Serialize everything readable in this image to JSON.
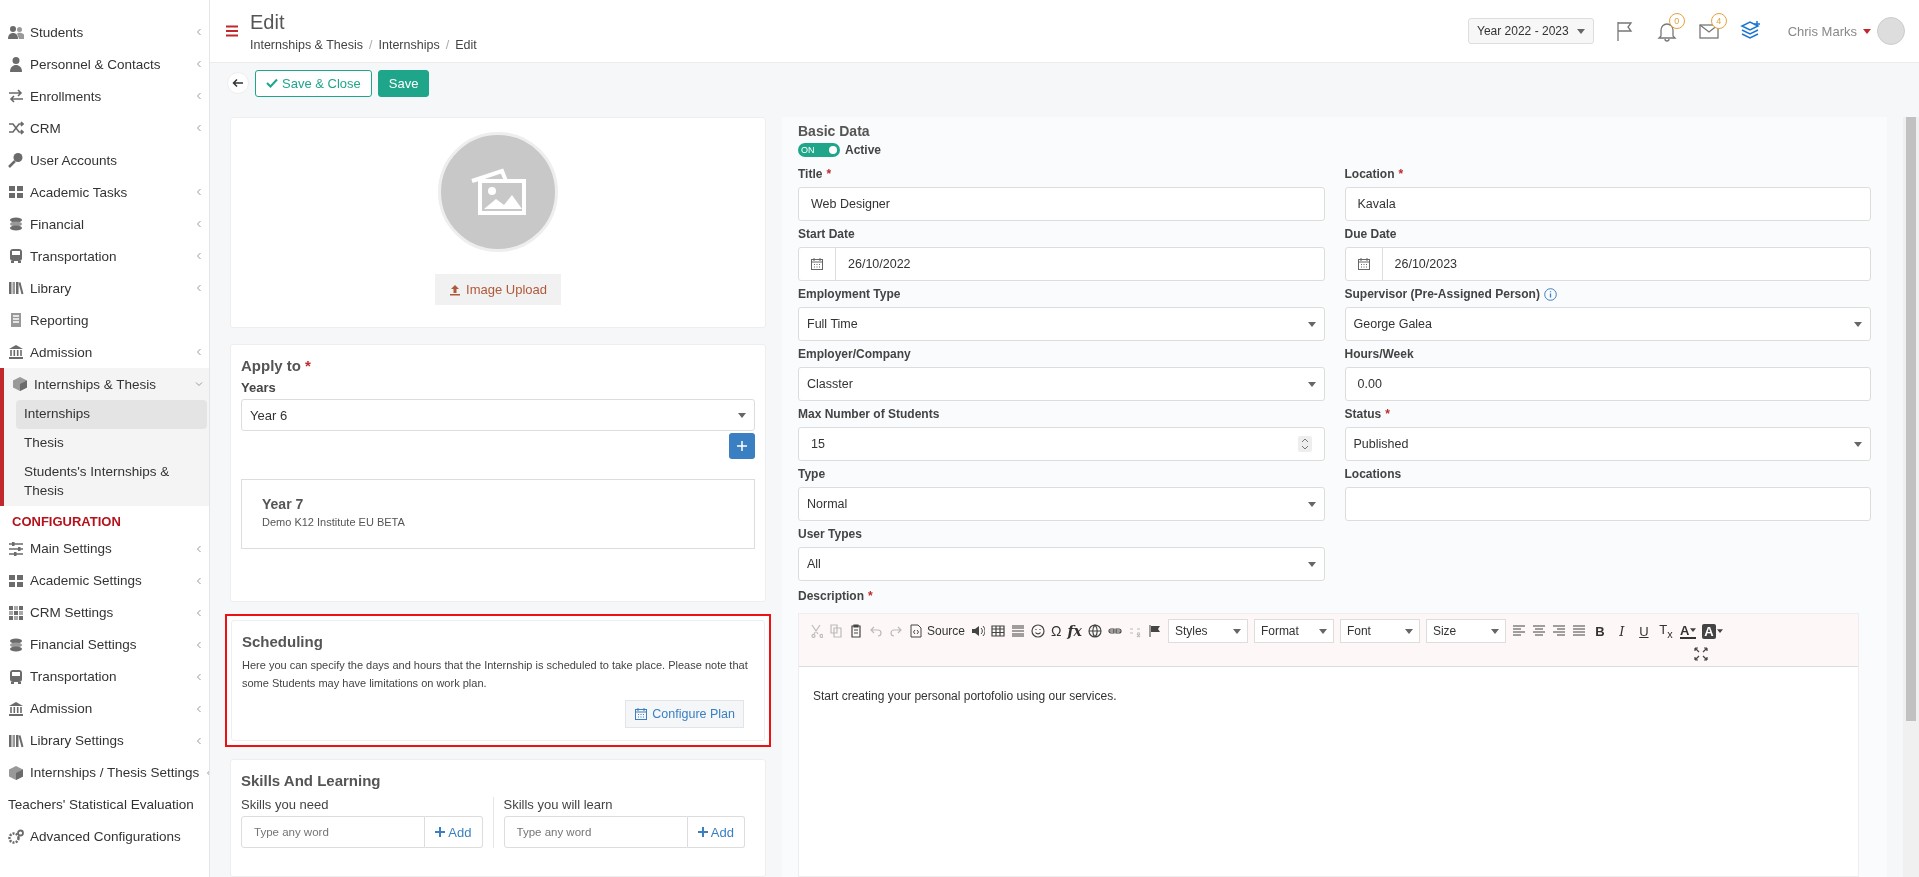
{
  "sidebar": {
    "items": [
      {
        "label": "Students",
        "expandable": true
      },
      {
        "label": "Personnel & Contacts",
        "expandable": true
      },
      {
        "label": "Enrollments",
        "expandable": true
      },
      {
        "label": "CRM",
        "expandable": true
      },
      {
        "label": "User Accounts",
        "expandable": false
      },
      {
        "label": "Academic Tasks",
        "expandable": true
      },
      {
        "label": "Financial",
        "expandable": true
      },
      {
        "label": "Transportation",
        "expandable": true
      },
      {
        "label": "Library",
        "expandable": true
      },
      {
        "label": "Reporting",
        "expandable": false
      },
      {
        "label": "Admission",
        "expandable": true
      },
      {
        "label": "Internships & Thesis",
        "expandable": true,
        "expanded": true,
        "selected": true,
        "children": [
          {
            "label": "Internships",
            "selected": true
          },
          {
            "label": "Thesis",
            "selected": false
          },
          {
            "label": "Students's Internships & Thesis",
            "selected": false
          }
        ]
      }
    ],
    "section_heading": "CONFIGURATION",
    "config_items": [
      {
        "label": "Main Settings",
        "expandable": true
      },
      {
        "label": "Academic Settings",
        "expandable": true
      },
      {
        "label": "CRM Settings",
        "expandable": true
      },
      {
        "label": "Financial Settings",
        "expandable": true
      },
      {
        "label": "Transportation",
        "expandable": true
      },
      {
        "label": "Admission",
        "expandable": true
      },
      {
        "label": "Library Settings",
        "expandable": true
      },
      {
        "label": "Internships / Thesis Settings",
        "expandable": true
      },
      {
        "label": "Teachers' Statistical Evaluation",
        "expandable": false
      },
      {
        "label": "Advanced Configurations",
        "expandable": false
      }
    ]
  },
  "header": {
    "title": "Edit",
    "breadcrumbs": [
      {
        "label": "Internships & Thesis",
        "separator": "/"
      },
      {
        "label": "Internships",
        "separator": "/"
      },
      {
        "label": "Edit"
      }
    ],
    "year_selector": "Year 2022 - 2023",
    "notifications_count": "0",
    "messages_count": "4",
    "user_name": "Chris Marks"
  },
  "toolbar": {
    "save_close": "Save & Close",
    "save": "Save"
  },
  "image_card": {
    "upload_button": "Image Upload"
  },
  "apply_to": {
    "title": "Apply to",
    "required_mark": "*",
    "years_label": "Years",
    "years_value": "Year 6",
    "entries": [
      {
        "title": "Year 7",
        "subtitle": "Demo K12 Institute EU BETA"
      }
    ]
  },
  "scheduling": {
    "title": "Scheduling",
    "highlighted": true,
    "text": "Here you can specify the days and hours that the Internship is scheduled to take place. Please note that some Students may have limitations on work plan.",
    "button": "Configure Plan"
  },
  "skills": {
    "title": "Skills And Learning",
    "columns": [
      {
        "label": "Skills you need",
        "placeholder": "Type any word",
        "button": "Add"
      },
      {
        "label": "Skills you will learn",
        "placeholder": "Type any word",
        "button": "Add"
      }
    ]
  },
  "basic_data": {
    "title": "Basic Data",
    "active_toggle": {
      "on": true,
      "text": "ON",
      "label": "Active"
    },
    "fields": [
      {
        "label": "Title",
        "kind": "text",
        "required_mark": "*",
        "value": "Web Designer"
      },
      {
        "label": "Location",
        "kind": "text",
        "required_mark": "*",
        "value": "Kavala"
      },
      {
        "label": "Start Date",
        "kind": "date",
        "value": "26/10/2022"
      },
      {
        "label": "Due Date",
        "kind": "date",
        "value": "26/10/2023"
      },
      {
        "label": "Employment Type",
        "kind": "select",
        "value": "Full Time"
      },
      {
        "label": "Supervisor (Pre-Assigned Person)",
        "kind": "select",
        "info": true,
        "value": "George Galea"
      },
      {
        "label": "Employer/Company",
        "kind": "select",
        "value": "Classter"
      },
      {
        "label": "Hours/Week",
        "kind": "text",
        "value": "0.00"
      },
      {
        "label": "Max Number of Students",
        "kind": "number",
        "value": "15"
      },
      {
        "label": "Status",
        "kind": "select",
        "required_mark": "*",
        "value": "Published"
      },
      {
        "label": "Type",
        "kind": "select",
        "value": "Normal"
      },
      {
        "label": "Locations",
        "kind": "text"
      },
      {
        "label": "User Types",
        "kind": "select",
        "value": "All"
      }
    ],
    "description": {
      "label": "Description",
      "required_mark": "*",
      "clipboard_enabled": false,
      "history_enabled": false,
      "unlink_enabled": false,
      "source_label": "Source",
      "special_char_label": "Ω",
      "formula_label": "fx",
      "combos": [
        "Styles",
        "Format",
        "Font",
        "Size"
      ],
      "style_buttons": [
        {
          "label": "B",
          "kind": "bold"
        },
        {
          "label": "I",
          "kind": "italic"
        },
        {
          "label": "U",
          "kind": "underline"
        },
        {
          "label": "T$_{x}$",
          "kind": "remove-format"
        }
      ],
      "color_buttons": [
        {
          "label": "A",
          "kind": "text-color"
        },
        {
          "label": "A",
          "kind": "background-color"
        }
      ],
      "content": "Start creating your personal portofolio using our services."
    }
  }
}
